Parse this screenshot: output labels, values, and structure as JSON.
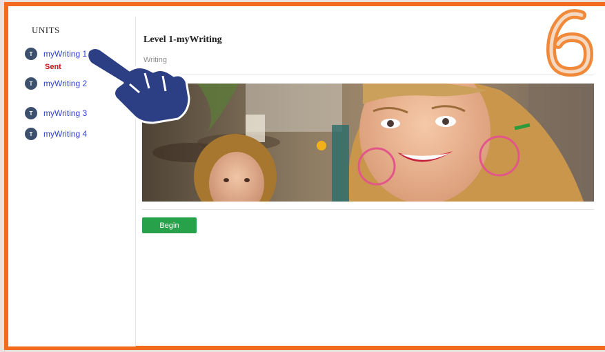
{
  "sidebar": {
    "title": "UNITS",
    "items": [
      {
        "avatar": "T",
        "label": "myWriting 1",
        "status": "Sent"
      },
      {
        "avatar": "T",
        "label": "myWriting 2"
      },
      {
        "avatar": "T",
        "label": "myWriting 3"
      },
      {
        "avatar": "T",
        "label": "myWriting 4"
      }
    ]
  },
  "main": {
    "title": "Level 1-myWriting",
    "subtitle": "Writing",
    "begin_label": "Begin"
  },
  "overlay": {
    "step_number": "6",
    "step_color": "#f08a3a",
    "pointer_icon": "pointing-hand-icon",
    "frame_color": "#f26a1b"
  },
  "colors": {
    "link": "#2f3fd0",
    "sent": "#d0121b",
    "begin": "#27a24a",
    "avatar": "#3c4f6d"
  }
}
